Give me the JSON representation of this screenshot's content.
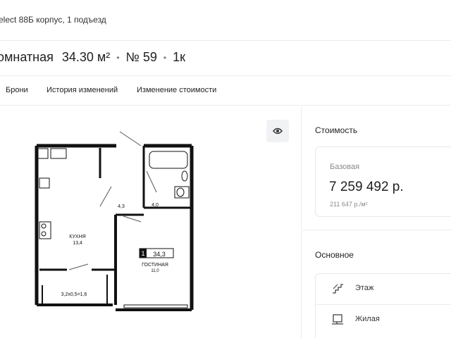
{
  "breadcrumb": {
    "text": "elect 88Б корпус, 1 подъезд"
  },
  "header": {
    "type": "омнатная",
    "area": "34.30 м²",
    "number": "№ 59",
    "rooms": "1к",
    "separator": "•"
  },
  "tabs": [
    {
      "label": "Брони"
    },
    {
      "label": "История изменений"
    },
    {
      "label": "Изменение стоимости"
    }
  ],
  "plan": {
    "kitchen_label": "КУХНЯ",
    "kitchen_area": "13,4",
    "living_label": "ГОСТИНАЯ",
    "living_area": "11,0",
    "room_count": "1",
    "total_area": "34,3",
    "hall_area": "4,3",
    "bath_area": "4,0",
    "balcony_label": "3,2x0,5=1,6"
  },
  "icons": {
    "view": "eye-icon",
    "floor": "stairs-icon",
    "living": "room-icon"
  },
  "sidebar": {
    "cost_title": "Стоимость",
    "base_label": "Базовая",
    "base_price": "7 259 492 р.",
    "price_per_m2": "211 647 р./м²",
    "main_title": "Основное",
    "rows": [
      {
        "label": "Этаж"
      },
      {
        "label": "Жилая"
      }
    ]
  }
}
